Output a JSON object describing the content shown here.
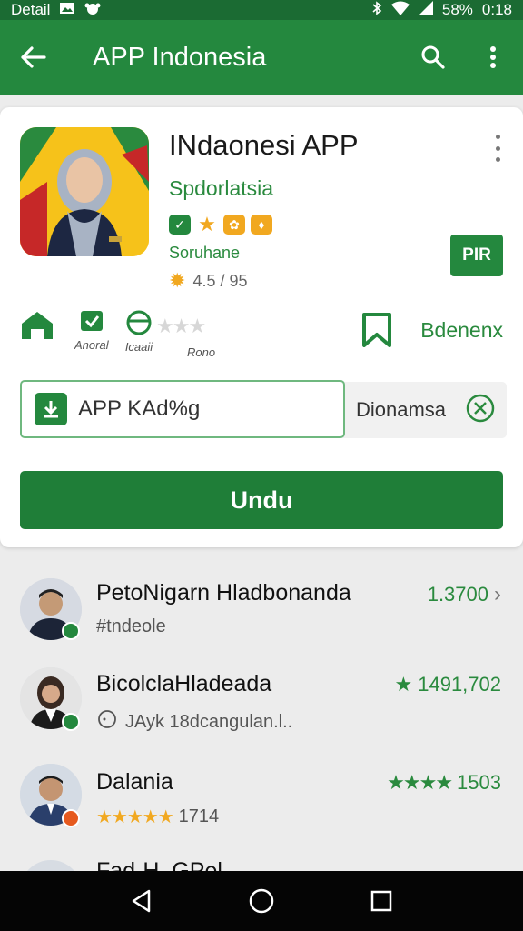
{
  "status_bar": {
    "left_text": "Detail",
    "battery": "58%",
    "time": "0:18"
  },
  "app_bar": {
    "title": "APP Indonesia"
  },
  "app": {
    "name": "INdaonesi APP",
    "developer": "Spdorlatsia",
    "category": "Soruhane",
    "rating_text": "4.5 / 95",
    "install_label": "PIR"
  },
  "info": {
    "items": [
      {
        "label": "Anoral"
      },
      {
        "label": "Icaaii"
      },
      {
        "label": "Rono"
      }
    ],
    "wishlist_label": "Bdenenx"
  },
  "search": {
    "value": "APP KAd%g",
    "secondary": "Dionamsa"
  },
  "download_label": "Undu",
  "list": [
    {
      "name": "PetoNigarn Hladbonanda",
      "sub": "#tndeole",
      "meta": "1.3700"
    },
    {
      "name": "BicolclaHladeada",
      "sub": "JAyk 18dcangulan.l..",
      "meta": "1491,702"
    },
    {
      "name": "Dalania",
      "sub": "1714",
      "meta": "1503"
    },
    {
      "name": "Fad-H. GPel",
      "sub": "",
      "meta": ""
    }
  ],
  "colors": {
    "primary": "#24883e",
    "status": "#1b6b33",
    "accent": "#f6c21a"
  }
}
